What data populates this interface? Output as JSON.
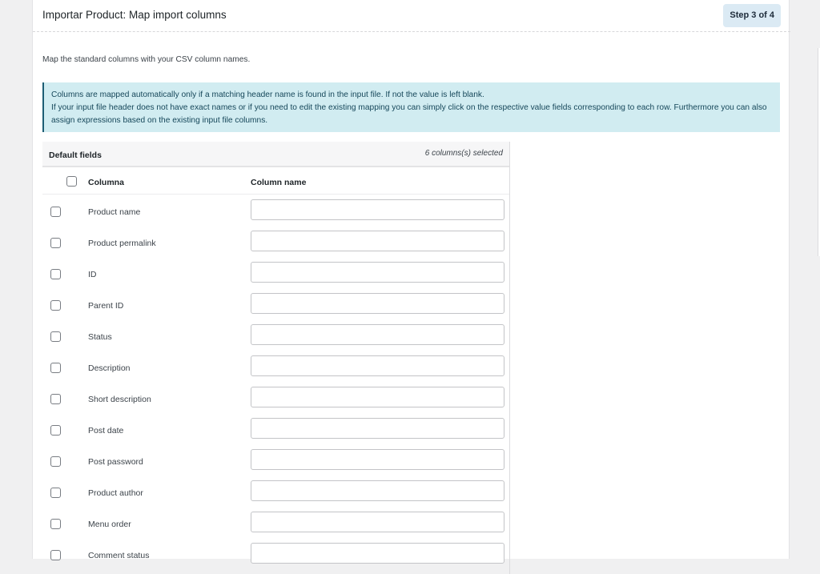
{
  "header": {
    "title": "Importar Product: Map import columns",
    "step": "Step 3 of 4"
  },
  "intro": "Map the standard columns with your CSV column names.",
  "notice": {
    "line1": "Columns are mapped automatically only if a matching header name is found in the input file. If not the value is left blank.",
    "line2": "If your input file header does not have exact names or if you need to edit the existing mapping you can simply click on the respective value fields corresponding to each row. Furthermore you can also assign expressions based on the existing input file columns."
  },
  "fields": {
    "title": "Default fields",
    "count": "6 columns(s) selected",
    "col_column": "Columna",
    "col_name": "Column name",
    "rows": [
      {
        "label": "Product name",
        "value": ""
      },
      {
        "label": "Product permalink",
        "value": ""
      },
      {
        "label": "ID",
        "value": ""
      },
      {
        "label": "Parent ID",
        "value": ""
      },
      {
        "label": "Status",
        "value": ""
      },
      {
        "label": "Description",
        "value": ""
      },
      {
        "label": "Short description",
        "value": ""
      },
      {
        "label": "Post date",
        "value": ""
      },
      {
        "label": "Post password",
        "value": ""
      },
      {
        "label": "Product author",
        "value": ""
      },
      {
        "label": "Menu order",
        "value": ""
      },
      {
        "label": "Comment status",
        "value": ""
      }
    ]
  }
}
